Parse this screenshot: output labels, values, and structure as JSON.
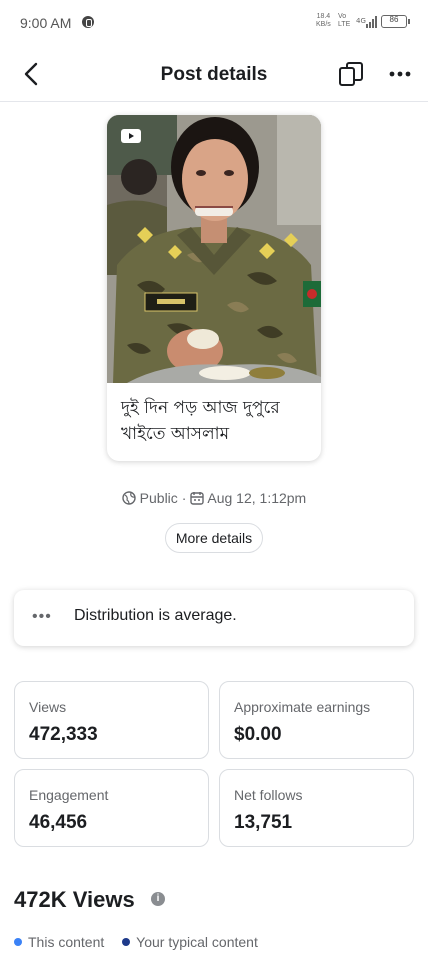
{
  "status_bar": {
    "time": "9:00 AM",
    "net_left_top": "18.4",
    "net_left_bottom": "KB/s",
    "net_right_top": "Vo",
    "net_right_bottom": "LTE",
    "net_signal": "4G",
    "battery": "86"
  },
  "header": {
    "title": "Post details"
  },
  "post": {
    "caption": "দুই দিন পড় আজ দুপুরে খাইতে  আসলাম",
    "visibility": "Public",
    "date": "Aug 12, 1:12pm",
    "more_details_label": "More details"
  },
  "distribution": {
    "text": "Distribution is average."
  },
  "stats": [
    {
      "label": "Views",
      "value": "472,333"
    },
    {
      "label": "Approximate earnings",
      "value": "$0.00"
    },
    {
      "label": "Engagement",
      "value": "46,456"
    },
    {
      "label": "Net follows",
      "value": "13,751"
    }
  ],
  "views_section": {
    "heading": "472K Views",
    "legend": [
      {
        "label": "This content",
        "color": "#3b82f6"
      },
      {
        "label": "Your typical content",
        "color": "#1e3a8a"
      }
    ]
  },
  "colors": {
    "text_primary": "#1c1e21",
    "text_secondary": "#65676b",
    "border": "#dadde1"
  }
}
